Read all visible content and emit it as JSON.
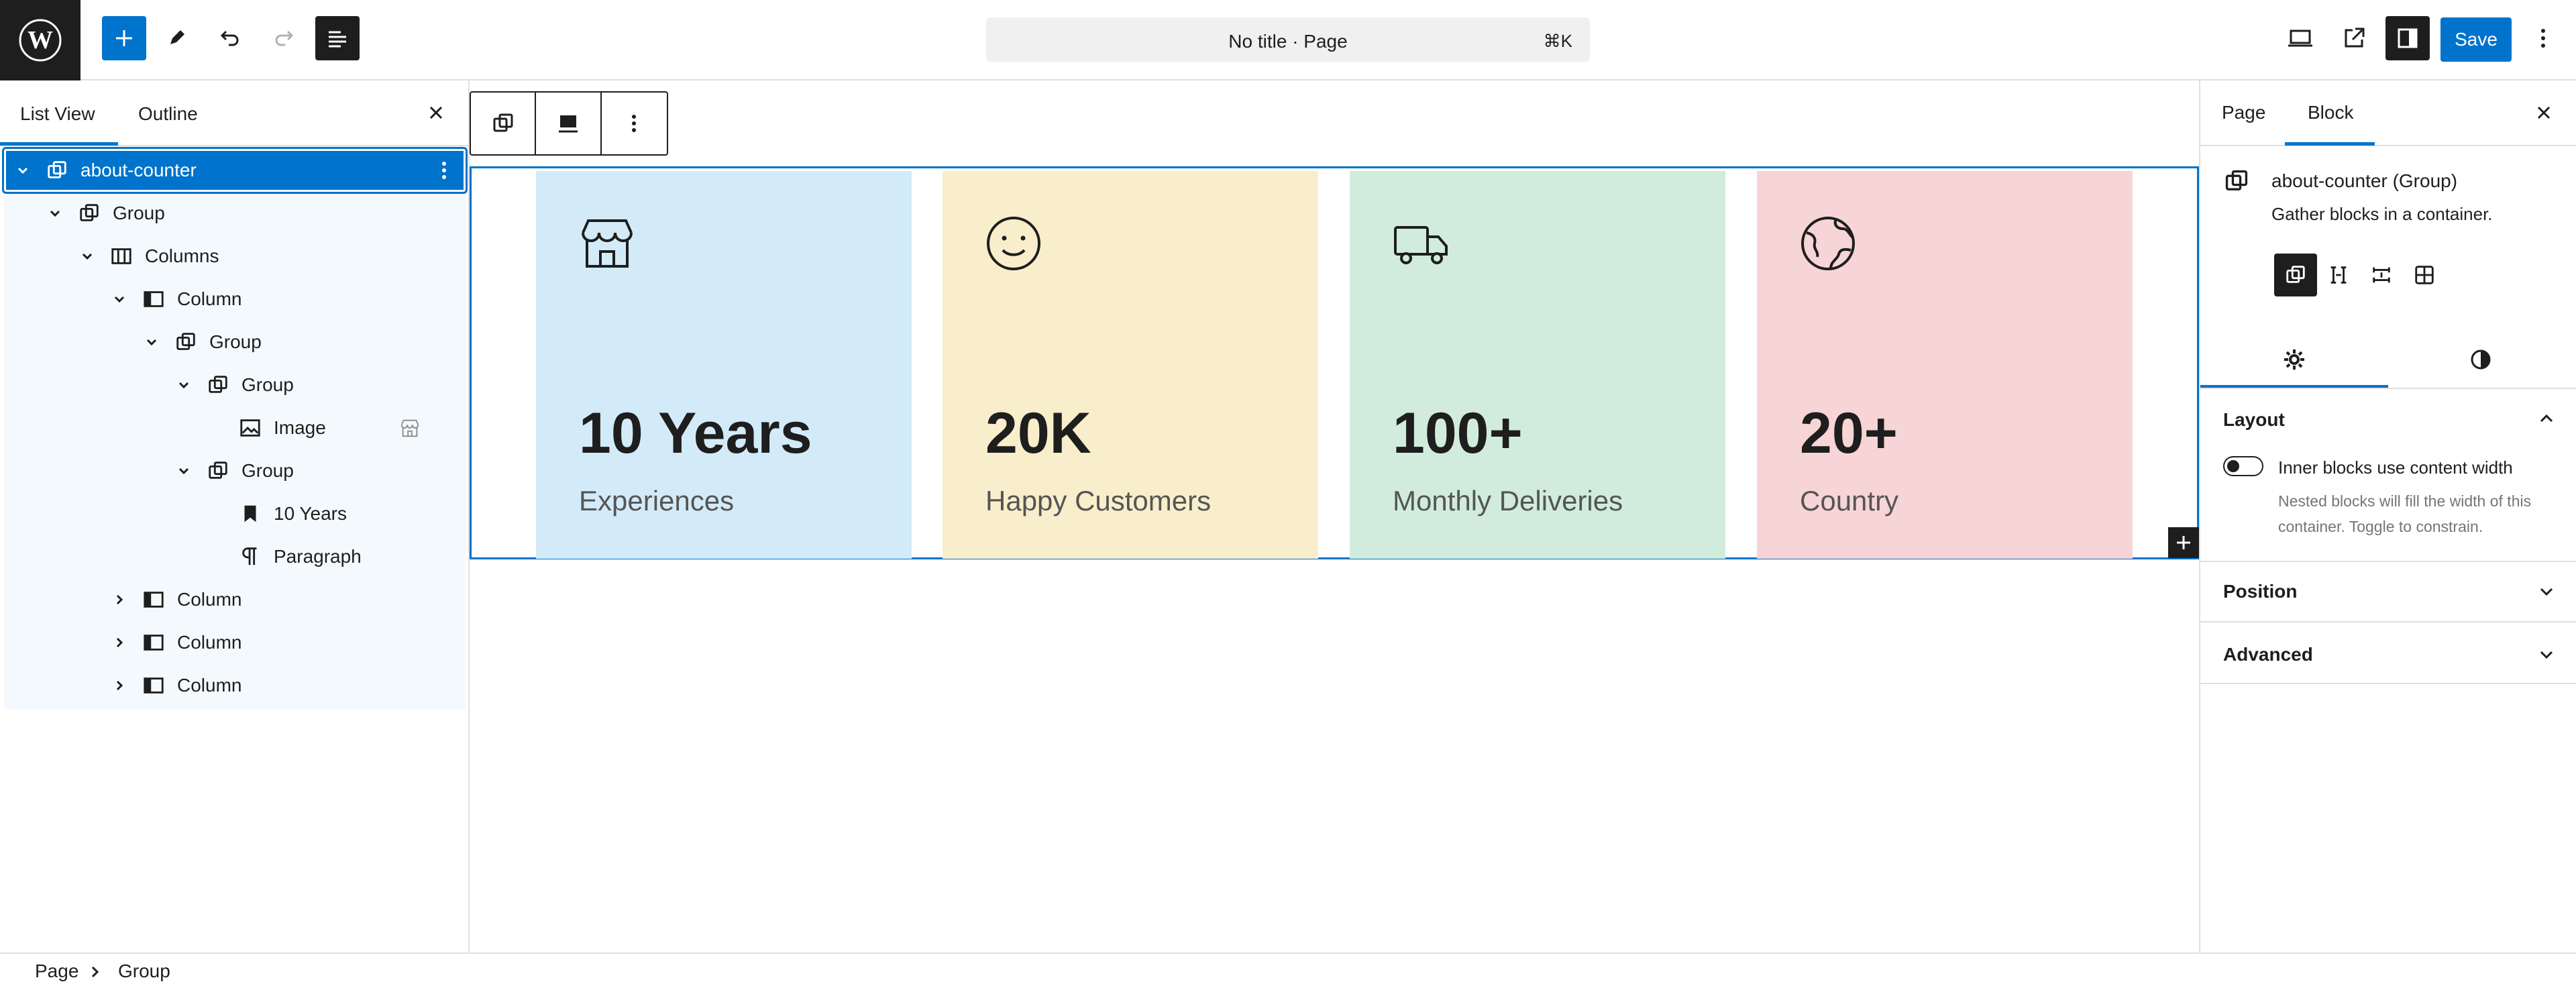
{
  "topbar": {
    "document_title": "No title · Page",
    "shortcut": "⌘K",
    "save_label": "Save",
    "icons": [
      "wordpress-logo",
      "add-block-icon",
      "edit-pencil-icon",
      "undo-icon",
      "redo-icon",
      "document-overview-icon",
      "desktop-view-icon",
      "external-preview-icon",
      "sidebar-toggle-icon",
      "options-kebab-icon"
    ]
  },
  "left_panel": {
    "tabs": [
      "List View",
      "Outline"
    ],
    "active_tab": "List View",
    "tree": [
      {
        "label": "about-counter",
        "depth": 0,
        "expanded": true,
        "icon": "group-icon",
        "selected": true
      },
      {
        "label": "Group",
        "depth": 1,
        "expanded": true,
        "icon": "group-icon"
      },
      {
        "label": "Columns",
        "depth": 2,
        "expanded": true,
        "icon": "columns-icon"
      },
      {
        "label": "Column",
        "depth": 3,
        "expanded": true,
        "icon": "column-icon"
      },
      {
        "label": "Group",
        "depth": 4,
        "expanded": true,
        "icon": "group-icon"
      },
      {
        "label": "Group",
        "depth": 5,
        "expanded": true,
        "icon": "group-icon"
      },
      {
        "label": "Image",
        "depth": 6,
        "icon": "image-icon"
      },
      {
        "label": "Group",
        "depth": 5,
        "expanded": true,
        "icon": "group-icon"
      },
      {
        "label": "10 Years",
        "depth": 6,
        "icon": "heading-bookmark-icon"
      },
      {
        "label": "Paragraph",
        "depth": 6,
        "icon": "paragraph-icon"
      },
      {
        "label": "Column",
        "depth": 3,
        "expanded": false,
        "icon": "column-icon"
      },
      {
        "label": "Column",
        "depth": 3,
        "expanded": false,
        "icon": "column-icon"
      },
      {
        "label": "Column",
        "depth": 3,
        "expanded": false,
        "icon": "column-icon"
      }
    ]
  },
  "cards": [
    {
      "number": "10 Years",
      "label": "Experiences",
      "icon": "store-icon",
      "bg": "#d3ebf9"
    },
    {
      "number": "20K",
      "label": "Happy Customers",
      "icon": "smiley-icon",
      "bg": "#f9eecb"
    },
    {
      "number": "100+",
      "label": "Monthly Deliveries",
      "icon": "truck-icon",
      "bg": "#d1ecdc"
    },
    {
      "number": "20+",
      "label": "Country",
      "icon": "globe-icon",
      "bg": "#f7d4d5"
    }
  ],
  "right_panel": {
    "tabs": [
      "Page",
      "Block"
    ],
    "active_tab": "Block",
    "block_title": "about-counter (Group)",
    "block_description": "Gather blocks in a container.",
    "layout_heading": "Layout",
    "toggle_label": "Inner blocks use content width",
    "toggle_help": "Nested blocks will fill the width of this container. Toggle to constrain.",
    "toggle_on": false,
    "position_heading": "Position",
    "advanced_heading": "Advanced"
  },
  "breadcrumb": [
    "Page",
    "Group"
  ],
  "colors": {
    "accent": "#0073cc",
    "dark": "#1e1e1e"
  }
}
